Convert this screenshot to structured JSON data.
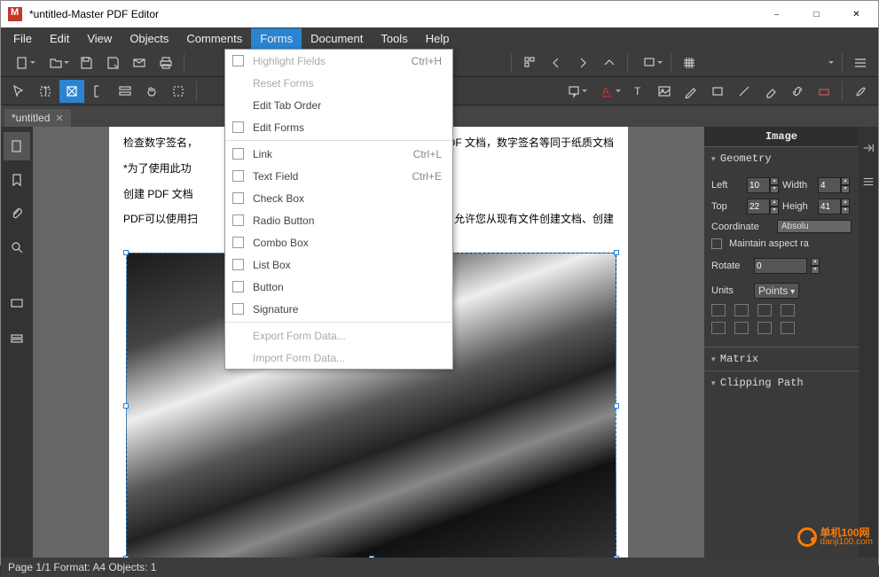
{
  "title": "*untitled-Master PDF Editor",
  "menubar": [
    "File",
    "Edit",
    "View",
    "Objects",
    "Comments",
    "Forms",
    "Document",
    "Tools",
    "Help"
  ],
  "active_menu": "Forms",
  "dropdown": {
    "items": [
      {
        "label": "Highlight Fields",
        "shortcut": "Ctrl+H",
        "disabled": true,
        "check": true
      },
      {
        "label": "Reset Forms",
        "disabled": true,
        "check": false
      },
      {
        "label": "Edit Tab Order",
        "check": false
      },
      {
        "label": "Edit Forms",
        "check": true
      },
      {
        "divider": true
      },
      {
        "label": "Link",
        "shortcut": "Ctrl+L",
        "check": true
      },
      {
        "label": "Text Field",
        "shortcut": "Ctrl+E",
        "check": true
      },
      {
        "label": "Check Box",
        "check": true
      },
      {
        "label": "Radio Button",
        "check": true
      },
      {
        "label": "Combo Box",
        "check": true
      },
      {
        "label": "List Box",
        "check": true
      },
      {
        "label": "Button",
        "check": true
      },
      {
        "label": "Signature",
        "check": true
      },
      {
        "divider": true
      },
      {
        "label": "Export Form Data...",
        "disabled": true,
        "check": false
      },
      {
        "label": "Import Form Data...",
        "disabled": true,
        "check": false
      }
    ]
  },
  "tab": {
    "name": "*untitled"
  },
  "doc_lines": [
    "检查数字签名，",
    "*为了使用此功",
    "创建 PDF 文档",
    "PDF可以使用扫"
  ],
  "doc_tail": "于 PDF 文档，数字签名等同于纸质文档",
  "doc_tail2": "itor 允许您从现有文件创建文档、创建",
  "panel": {
    "title": "Image",
    "sections": {
      "geometry": {
        "title": "Geometry",
        "left_label": "Left",
        "left_val": "10",
        "width_label": "Width",
        "width_val": "4",
        "top_label": "Top",
        "top_val": "22",
        "height_label": "Heigh",
        "height_val": "41",
        "coord_label": "Coordinate",
        "coord_val": "Absolu",
        "aspect": "Maintain aspect ra",
        "rotate_label": "Rotate",
        "rotate_val": "0",
        "units_label": "Units",
        "units_val": "Points"
      },
      "matrix": {
        "title": "Matrix"
      },
      "clip": {
        "title": "Clipping Path"
      }
    }
  },
  "status": "Page 1/1 Format: A4 Objects: 1",
  "watermark": {
    "brand": "单机100网",
    "url": "danji100.com"
  }
}
